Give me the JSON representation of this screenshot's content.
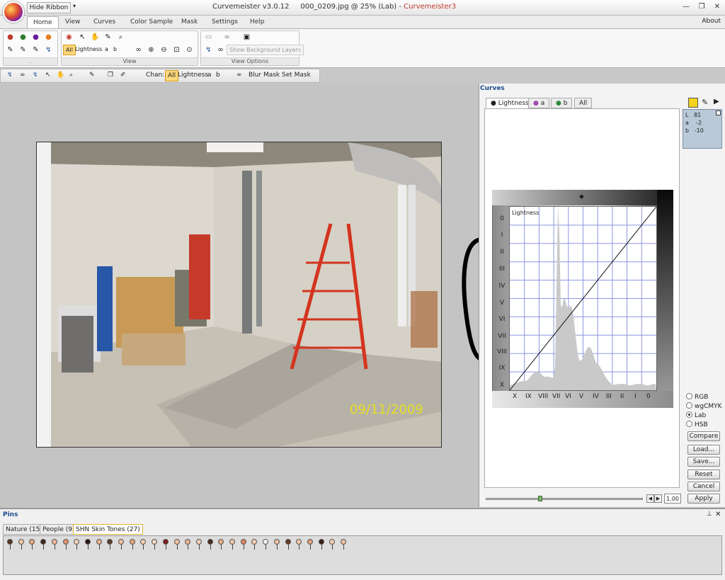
{
  "window": {
    "hide_ribbon": "Hide Ribbon",
    "quick_access_arrow": "▾",
    "title_app": "Curvemeister v3.0.12",
    "title_file": "000_0209.jpg @ 25% (Lab)",
    "title_product": "Curvemeister3",
    "minimize": "—",
    "restore": "❐",
    "close": "✕"
  },
  "menu": {
    "tabs": [
      "Home",
      "View",
      "Curves",
      "Color Sample",
      "Mask",
      "Settings",
      "Help"
    ],
    "active": "Home",
    "about": "About"
  },
  "ribbon": {
    "group1_label": ".",
    "group2_label": "View",
    "group3_label": "View Options",
    "channel_all": "All",
    "channel_lightness": "Lightness",
    "channel_a": "a",
    "channel_b": "b",
    "show_background_layers": "Show Background Layers"
  },
  "toolbar2": {
    "chan_label": "Chan:",
    "all": "All",
    "lightness": "Lightness",
    "a": "a",
    "b": "b",
    "blur_mask": "Blur Mask",
    "set_mask": "Set Mask"
  },
  "photo": {
    "date_stamp": "09/11/2009"
  },
  "curves": {
    "header": "Curves",
    "tabs": [
      "Lightness",
      "a",
      "b",
      "All"
    ],
    "active_tab": "Lightness",
    "plot_label": "Lightness",
    "y_labels": [
      "0",
      "I",
      "II",
      "III",
      "IV",
      "V",
      "VI",
      "VII",
      "VIII",
      "IX",
      "X"
    ],
    "x_labels": [
      "X",
      "IX",
      "VIII",
      "VII",
      "VI",
      "V",
      "IV",
      "III",
      "II",
      "I",
      "0"
    ],
    "info": {
      "L": "81",
      "a": "-2",
      "b": "-10"
    },
    "color_modes": [
      "RGB",
      "wgCMYK",
      "Lab",
      "HSB"
    ],
    "selected_mode": "Lab",
    "buttons": [
      "Compare",
      "Load...",
      "Save...",
      "Reset",
      "Cancel",
      "Apply"
    ],
    "zoom_value": "1.00",
    "histogram_peak_level": 0.94
  },
  "pins": {
    "header": "Pins",
    "tabs": [
      "Nature (15)",
      "People (9)",
      "SHN Skin Tones (27)"
    ],
    "active_tab": "SHN Skin Tones (27)",
    "colors": [
      "#5a3520",
      "#f2c9a5",
      "#e7a87c",
      "#3d2418",
      "#f0b894",
      "#e0916c",
      "#f6d3b8",
      "#2a1810",
      "#eab18c",
      "#5b3a28",
      "#f1c0a0",
      "#e4a57c",
      "#f3cfb2",
      "#f6d6bf",
      "#7a1e1e",
      "#f0c2a0",
      "#e9b592",
      "#f2cfb6",
      "#4a2a1a",
      "#e9ad88",
      "#f1c7a6",
      "#d98660",
      "#f4cdb0",
      "#faf4ee",
      "#eec0a0",
      "#6b3a22",
      "#f0c8aa",
      "#e2a07a",
      "#3b1e12",
      "#f3cdb0",
      "#ecc0a2"
    ]
  }
}
